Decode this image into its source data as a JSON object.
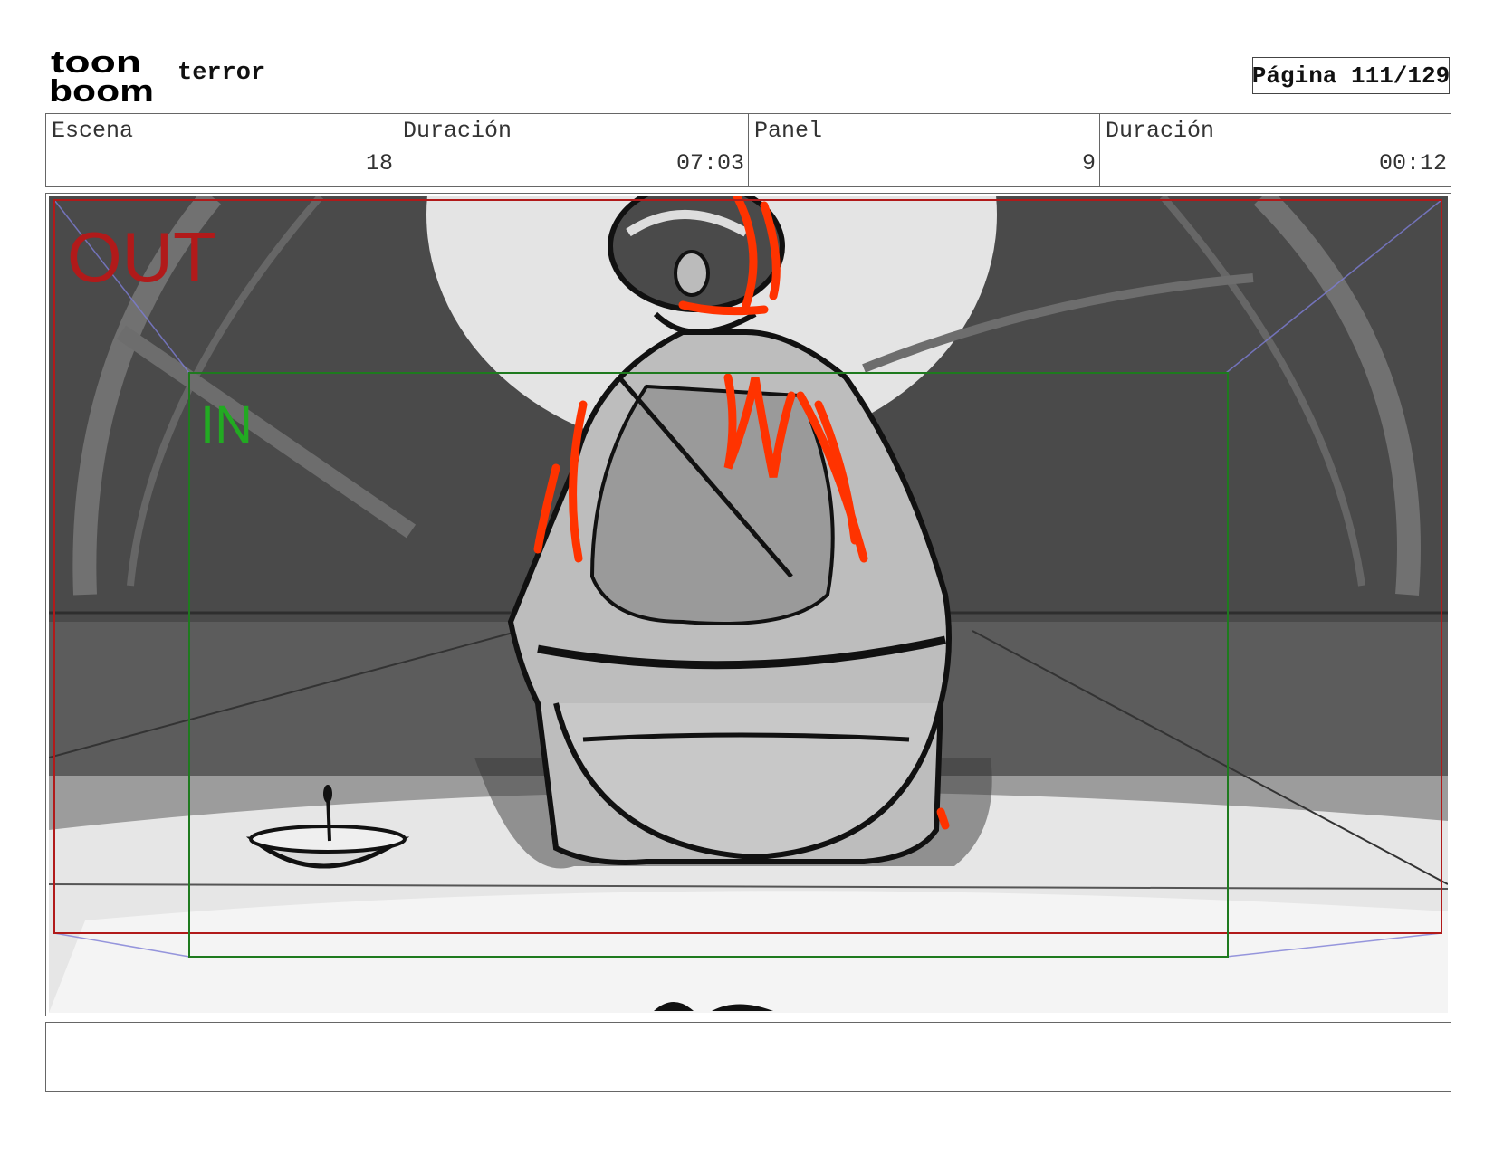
{
  "header": {
    "logo_line1": "toon",
    "logo_line2": "boom",
    "project_title": "terror",
    "page_label": "Página 111/129"
  },
  "info": [
    {
      "label": "Escena",
      "value": "18"
    },
    {
      "label": "Duración",
      "value": "07:03"
    },
    {
      "label": "Panel",
      "value": "9"
    },
    {
      "label": "Duración",
      "value": "00:12"
    }
  ],
  "panel": {
    "out_label": "OUT",
    "in_label": "IN",
    "colors": {
      "out_frame": "#b11a1a",
      "in_frame": "#1e7a1e",
      "accent": "#ff3300"
    }
  },
  "notes": ""
}
